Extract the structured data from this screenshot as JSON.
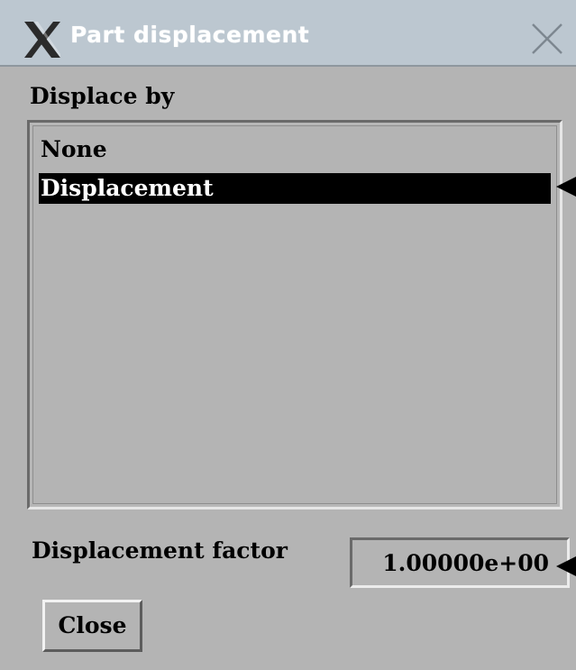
{
  "window": {
    "title": "Part displacement",
    "logo_icon": "x-window-system-logo",
    "close_icon": "close-icon",
    "titlebar_color": "#bcc7d0",
    "body_color": "#b4b4b4"
  },
  "displace_by": {
    "label": "Displace by",
    "options": [
      {
        "label": "None",
        "selected": false
      },
      {
        "label": "Displacement",
        "selected": true
      }
    ]
  },
  "factor": {
    "label": "Displacement factor",
    "value": "1.00000e+00"
  },
  "buttons": {
    "close_label": "Close"
  }
}
